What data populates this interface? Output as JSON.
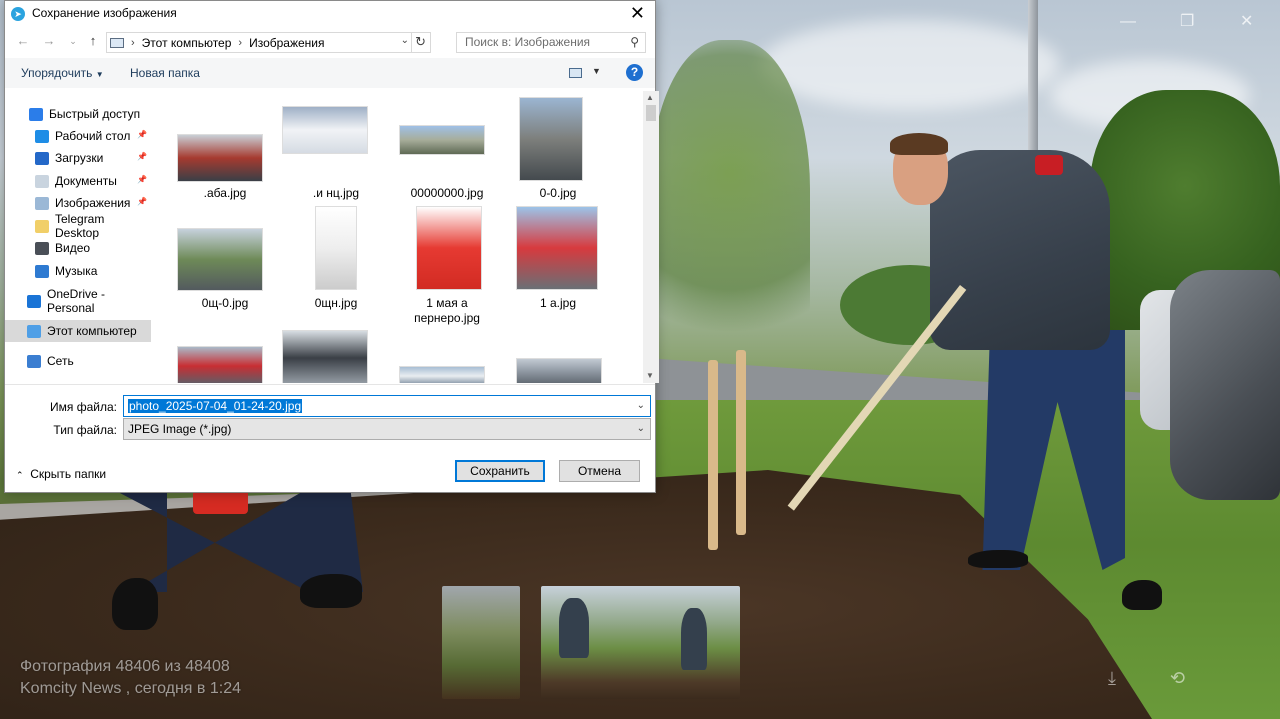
{
  "dialog": {
    "title": "Сохранение изображения",
    "nav": {
      "back_icon": "arrow-left-icon",
      "forward_icon": "arrow-right-icon",
      "up_icon": "arrow-up-icon",
      "breadcrumb": [
        "Этот компьютер",
        "Изображения"
      ],
      "search_placeholder": "Поиск в: Изображения"
    },
    "commands": {
      "organize": "Упорядочить",
      "new_folder": "Новая папка",
      "help": "?"
    },
    "sidebar": [
      {
        "label": "Быстрый доступ",
        "color": "#2b7de9"
      },
      {
        "label": "Рабочий стол",
        "color": "#1e8de6",
        "pinned": true
      },
      {
        "label": "Загрузки",
        "color": "#2468c8",
        "pinned": true
      },
      {
        "label": "Документы",
        "color": "#c9d4df",
        "pinned": true
      },
      {
        "label": "Изображения",
        "color": "#9bb8d6",
        "pinned": true
      },
      {
        "label": "Telegram Desktop",
        "color": "#f1cf68"
      },
      {
        "label": "Видео",
        "color": "#4a4f57"
      },
      {
        "label": "Музыка",
        "color": "#2e7ad1"
      },
      {
        "label": "OneDrive - Personal",
        "color": "#1a74d6"
      },
      {
        "label": "Этот компьютер",
        "color": "#4f9fe6",
        "selected": true
      },
      {
        "label": "Сеть",
        "color": "#3b7ed1"
      }
    ],
    "files": [
      {
        "name": ".аба.jpg",
        "colors": [
          "#c9cfd6",
          "#a63a2f",
          "#3a3f46"
        ]
      },
      {
        "name": ".и нц.jpg",
        "colors": [
          "#9fb0c6",
          "#f1f3f6",
          "#d5dbe3"
        ]
      },
      {
        "name": "00000000.jpg",
        "colors": [
          "#9fc0e6",
          "#a7ad9a",
          "#5f6a55"
        ]
      },
      {
        "name": "0-0.jpg",
        "colors": [
          "#9bb5d1",
          "#7d7f7c",
          "#444a4e"
        ]
      },
      {
        "name": "0щ-0.jpg",
        "colors": [
          "#c6d1dc",
          "#6e8a58",
          "#535a5e"
        ]
      },
      {
        "name": "0щн.jpg",
        "colors": [
          "#ffffff",
          "#eeeeee",
          "#cccccc"
        ]
      },
      {
        "name": "1 мая а пернеро.jpg",
        "colors": [
          "#ffffff",
          "#e63a32",
          "#d22b23"
        ]
      },
      {
        "name": "1 а.jpg",
        "colors": [
          "#9cc3e8",
          "#d73a3e",
          "#6a6f75"
        ]
      },
      {
        "name": "",
        "colors": [
          "#aab9c8",
          "#c82e33",
          "#59616a"
        ]
      },
      {
        "name": "",
        "colors": [
          "#d7dde2",
          "#3a3f46",
          "#9aa2aa"
        ]
      },
      {
        "name": "",
        "colors": [
          "#a8bed4",
          "#e9edf1",
          "#7b8c9e"
        ]
      },
      {
        "name": "",
        "colors": [
          "#c2cad3",
          "#8d96a0",
          "#5c646d"
        ]
      }
    ],
    "filename_label": "Имя файла:",
    "filename_value": "photo_2025-07-04_01-24-20.jpg",
    "filetype_label": "Тип файла:",
    "filetype_value": "JPEG Image (*.jpg)",
    "hide_folders": "Скрыть папки",
    "save": "Сохранить",
    "cancel": "Отмена"
  },
  "viewer": {
    "caption_line1": "Фотография 48406 из 48408",
    "caption_line2": "Komcity News , сегодня в 1:24"
  }
}
